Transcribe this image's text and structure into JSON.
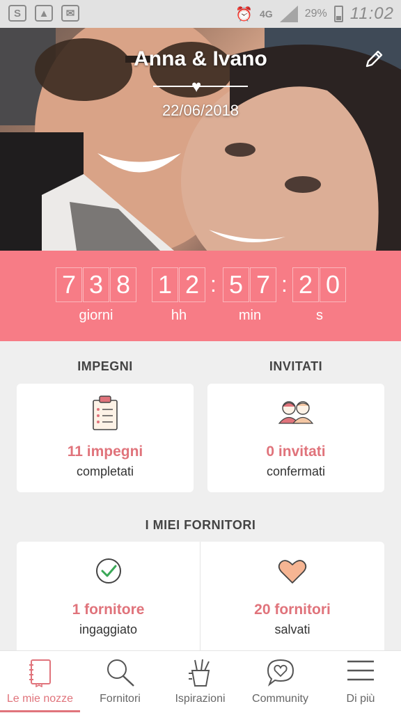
{
  "status_bar": {
    "network": "4G",
    "battery": "29%",
    "time": "11:02"
  },
  "hero": {
    "title": "Anna & Ivano",
    "date": "22/06/2018"
  },
  "countdown": {
    "days_digits": [
      "7",
      "3",
      "8"
    ],
    "hours_digits": [
      "1",
      "2"
    ],
    "minutes_digits": [
      "5",
      "7"
    ],
    "seconds_digits": [
      "2",
      "0"
    ],
    "separator": ":",
    "days_label": "giorni",
    "hours_label": "hh",
    "minutes_label": "min",
    "seconds_label": "s"
  },
  "impegni": {
    "heading": "IMPEGNI",
    "count": "11 impegni",
    "sub": "completati"
  },
  "invitati": {
    "heading": "INVITATI",
    "count": "0 invitati",
    "sub": "confermati"
  },
  "fornitori": {
    "heading": "I MIEI FORNITORI",
    "hired_count": "1 fornitore",
    "hired_sub": "ingaggiato",
    "saved_count": "20 fornitori",
    "saved_sub": "salvati"
  },
  "nav": {
    "items": [
      {
        "label": "Le mie nozze",
        "icon": "notebook-icon"
      },
      {
        "label": "Fornitori",
        "icon": "search-icon"
      },
      {
        "label": "Ispirazioni",
        "icon": "pencil-cup-icon"
      },
      {
        "label": "Community",
        "icon": "heart-chat-icon"
      },
      {
        "label": "Di più",
        "icon": "menu-icon"
      }
    ]
  },
  "colors": {
    "accent": "#f77c86",
    "accent_text": "#e0737b"
  }
}
